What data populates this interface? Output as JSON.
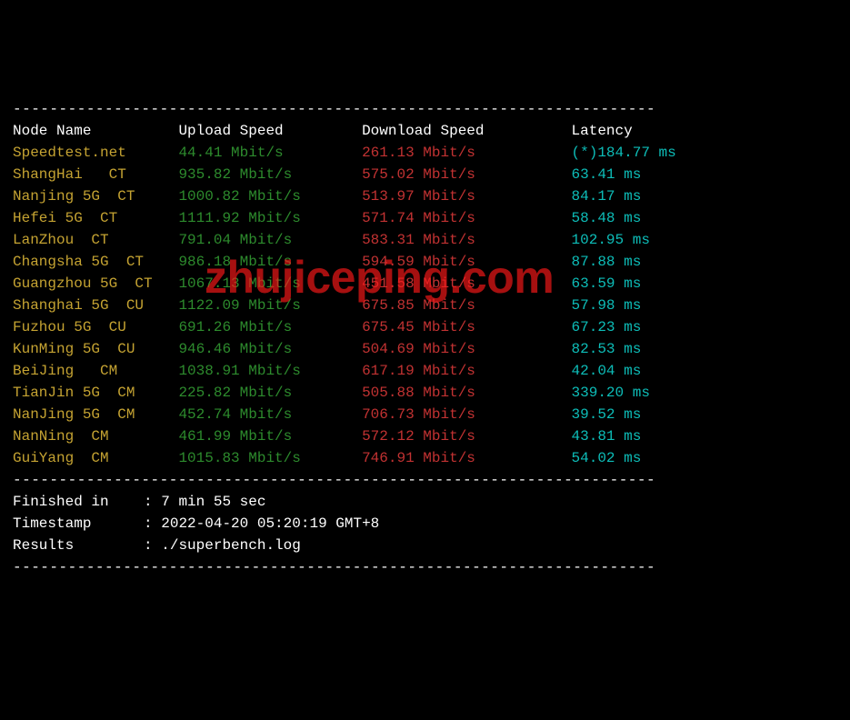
{
  "headers": {
    "node_name": "Node Name",
    "upload": "Upload Speed",
    "download": "Download Speed",
    "latency": "Latency"
  },
  "rows": [
    {
      "name": "Speedtest.net",
      "upload": "44.41 Mbit/s",
      "download": "261.13 Mbit/s",
      "latency": "(*)184.77 ms"
    },
    {
      "name": "ShangHai   CT",
      "upload": "935.82 Mbit/s",
      "download": "575.02 Mbit/s",
      "latency": "63.41 ms"
    },
    {
      "name": "Nanjing 5G  CT",
      "upload": "1000.82 Mbit/s",
      "download": "513.97 Mbit/s",
      "latency": "84.17 ms"
    },
    {
      "name": "Hefei 5G  CT",
      "upload": "1111.92 Mbit/s",
      "download": "571.74 Mbit/s",
      "latency": "58.48 ms"
    },
    {
      "name": "LanZhou  CT",
      "upload": "791.04 Mbit/s",
      "download": "583.31 Mbit/s",
      "latency": "102.95 ms"
    },
    {
      "name": "Changsha 5G  CT",
      "upload": "986.18 Mbit/s",
      "download": "594.59 Mbit/s",
      "latency": "87.88 ms"
    },
    {
      "name": "Guangzhou 5G  CT",
      "upload": "1067.13 Mbit/s",
      "download": "451.58 Mbit/s",
      "latency": "63.59 ms"
    },
    {
      "name": "Shanghai 5G  CU",
      "upload": "1122.09 Mbit/s",
      "download": "675.85 Mbit/s",
      "latency": "57.98 ms"
    },
    {
      "name": "Fuzhou 5G  CU",
      "upload": "691.26 Mbit/s",
      "download": "675.45 Mbit/s",
      "latency": "67.23 ms"
    },
    {
      "name": "KunMing 5G  CU",
      "upload": "946.46 Mbit/s",
      "download": "504.69 Mbit/s",
      "latency": "82.53 ms"
    },
    {
      "name": "BeiJing   CM",
      "upload": "1038.91 Mbit/s",
      "download": "617.19 Mbit/s",
      "latency": "42.04 ms"
    },
    {
      "name": "TianJin 5G  CM",
      "upload": "225.82 Mbit/s",
      "download": "505.88 Mbit/s",
      "latency": "339.20 ms"
    },
    {
      "name": "NanJing 5G  CM",
      "upload": "452.74 Mbit/s",
      "download": "706.73 Mbit/s",
      "latency": "39.52 ms"
    },
    {
      "name": "NanNing  CM",
      "upload": "461.99 Mbit/s",
      "download": "572.12 Mbit/s",
      "latency": "43.81 ms"
    },
    {
      "name": "GuiYang  CM",
      "upload": "1015.83 Mbit/s",
      "download": "746.91 Mbit/s",
      "latency": "54.02 ms"
    }
  ],
  "footer": {
    "finished_label": "Finished in",
    "finished_value": "7 min 55 sec",
    "timestamp_label": "Timestamp",
    "timestamp_value": "2022-04-20 05:20:19 GMT+8",
    "results_label": "Results",
    "results_value": "./superbench.log"
  },
  "divider": "----------------------------------------------------------------------",
  "watermark": "zhujiceping.com"
}
